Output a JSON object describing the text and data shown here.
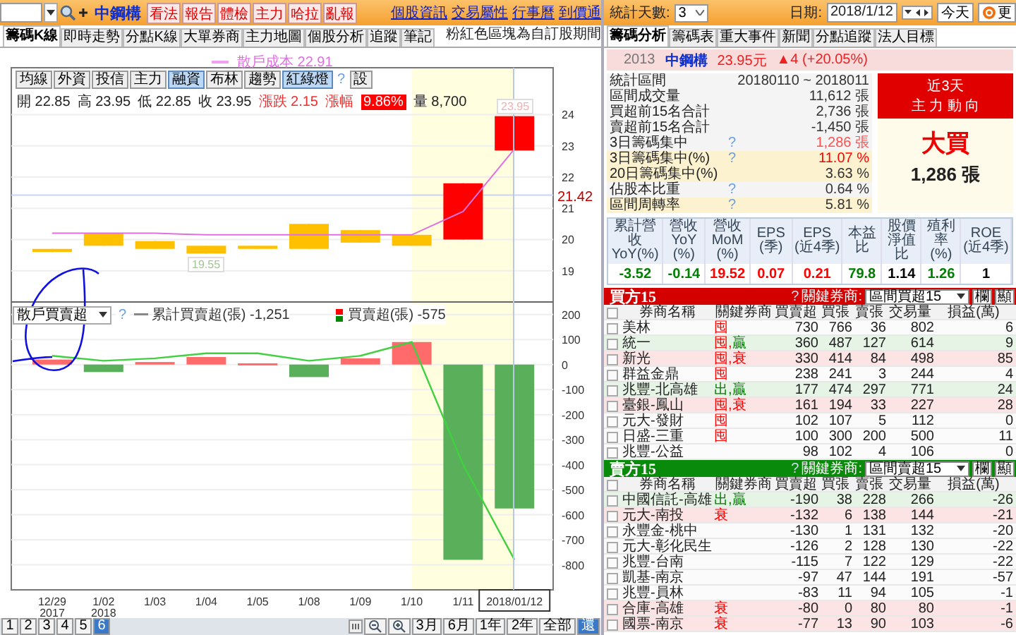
{
  "left": {
    "toolbar": {
      "stock_name": "中鋼構",
      "actions": [
        "看法",
        "報告",
        "體檢",
        "主力",
        "哈拉",
        "亂報"
      ],
      "links": [
        "個股資訊",
        "交易屬性",
        "行事曆",
        "到價通"
      ]
    },
    "tabs": [
      {
        "label": "籌碼K線",
        "selected": true
      },
      {
        "label": "即時走勢",
        "selected": false
      },
      {
        "label": "分點K線",
        "selected": false
      },
      {
        "label": "大單券商",
        "selected": false
      },
      {
        "label": "主力地圖",
        "selected": false
      },
      {
        "label": "個股分析",
        "selected": false
      },
      {
        "label": "追蹤",
        "selected": false
      },
      {
        "label": "筆記",
        "selected": false
      }
    ],
    "note": "粉紅色區塊為自訂股期間",
    "cost_value": "22.91",
    "chart_buttons": [
      {
        "label": "均線",
        "selected": false
      },
      {
        "label": "外資",
        "selected": false
      },
      {
        "label": "投信",
        "selected": false
      },
      {
        "label": "主力",
        "selected": false
      },
      {
        "label": "融資",
        "selected": true
      },
      {
        "label": "布林",
        "selected": false
      },
      {
        "label": "趨勢",
        "selected": false
      },
      {
        "label": "紅綠燈",
        "selected": true
      }
    ],
    "help": "?",
    "settings_button": "設",
    "quote": [
      {
        "label": "開",
        "value": "22.85"
      },
      {
        "label": "高",
        "value": "23.95"
      },
      {
        "label": "低",
        "value": "22.85"
      },
      {
        "label": "收",
        "value": "23.95"
      }
    ],
    "change": {
      "label": "漲跌",
      "value": "2.15"
    },
    "change_pct": {
      "label": "漲幅",
      "value": "9.86%"
    },
    "volume": {
      "label": "量",
      "value": "8,700"
    },
    "price_chart": {
      "high_tag": "23.95",
      "low_tag": "19.55",
      "candles": [
        {
          "color": "#ffc000"
        },
        {
          "color": "#ffc000"
        },
        {
          "color": "#ffc000"
        },
        {
          "color": "#ffc000"
        },
        {
          "color": "#ffc000"
        },
        {
          "color": "#ffc000"
        },
        {
          "color": "#ffc000"
        },
        {
          "color": "#ffc000"
        },
        {
          "color": "#ff0000"
        },
        {
          "color": "#ff0000"
        }
      ],
      "chart_data": {
        "type": "candlestick",
        "ylim": [
          18.0,
          25.5
        ],
        "yticks": [
          19,
          20,
          21,
          22,
          23,
          24
        ],
        "grid": true,
        "ref_lines": [
          {
            "axis": "y",
            "value": 21.42,
            "label": "21.42"
          }
        ],
        "series": [
          {
            "ohlc": [
              [
                19.7,
                19.7,
                19.6,
                19.6
              ],
              [
                20.2,
                20.2,
                19.8,
                19.8
              ],
              [
                19.95,
                19.95,
                19.7,
                19.7
              ],
              [
                19.8,
                19.8,
                19.55,
                19.55
              ],
              [
                19.8,
                19.8,
                19.7,
                19.7
              ],
              [
                20.5,
                20.5,
                19.7,
                19.7
              ],
              [
                20.3,
                20.3,
                19.9,
                19.9
              ],
              [
                20.15,
                20.15,
                19.8,
                19.8
              ],
              [
                20.0,
                21.8,
                20.0,
                21.8
              ],
              [
                22.85,
                23.95,
                22.85,
                23.95
              ]
            ]
          },
          {
            "name": "散戶成本",
            "type": "line",
            "color": "#e070e0",
            "values": [
              20.2,
              20.2,
              20.2,
              20.15,
              20.15,
              20.15,
              20.15,
              20.15,
              20.9,
              22.9
            ]
          }
        ]
      }
    },
    "flow_chart": {
      "selector": "散戶買賣超",
      "help": "?",
      "line_legend_value": "-1,251",
      "bar_legend_value": "-575",
      "year_labels": [
        "2017",
        "2018"
      ],
      "chart_data": {
        "type": "bar",
        "categories": [
          "12/29",
          "1/02",
          "1/03",
          "1/04",
          "1/05",
          "1/08",
          "1/09",
          "1/10",
          "1/11",
          "2018/01/12"
        ],
        "ylim": [
          -900,
          250
        ],
        "yticks": [
          200,
          100,
          0,
          -100,
          -200,
          -300,
          -400,
          -500,
          -600,
          -700,
          -800
        ],
        "grid": true,
        "series": [
          {
            "name": "買賣超(張)",
            "values": [
              20,
              -30,
              10,
              30,
              5,
              -50,
              25,
              90,
              -780,
              -575
            ],
            "colors": [
              "#ff6a6a",
              "#5aaf5a",
              "#ff6a6a",
              "#ff6a6a",
              "#ff6a6a",
              "#5aaf5a",
              "#ff6a6a",
              "#ff6a6a",
              "#5aaf5a",
              "#5aaf5a"
            ]
          },
          {
            "name": "累計買賣超(張)",
            "type": "line",
            "color": "#40d040",
            "values": [
              35,
              15,
              25,
              45,
              45,
              15,
              35,
              90,
              -400,
              -780
            ]
          }
        ]
      }
    },
    "pages": [
      {
        "label": "1",
        "selected": false
      },
      {
        "label": "2",
        "selected": false
      },
      {
        "label": "3",
        "selected": false
      },
      {
        "label": "4",
        "selected": false
      },
      {
        "label": "5",
        "selected": false
      },
      {
        "label": "6",
        "selected": true
      }
    ],
    "ranges": [
      {
        "label": "3月",
        "selected": false
      },
      {
        "label": "6月",
        "selected": false
      },
      {
        "label": "1年",
        "selected": false
      },
      {
        "label": "2年",
        "selected": false
      },
      {
        "label": "全部",
        "selected": false
      },
      {
        "label": "還",
        "selected": true
      }
    ]
  },
  "right": {
    "days_label": "統計天數:",
    "days_value": "3",
    "date_label": "日期:",
    "date_value": "2018/1/12",
    "today_button": "今天",
    "refresh_button": "更",
    "tabs": [
      {
        "label": "籌碼分析",
        "selected": true
      },
      {
        "label": "籌碼表",
        "selected": false
      },
      {
        "label": "重大事件",
        "selected": false
      },
      {
        "label": "新聞",
        "selected": false
      },
      {
        "label": "分點追蹤",
        "selected": false
      },
      {
        "label": "法人目標",
        "selected": false
      }
    ],
    "header": {
      "code": "2013",
      "name": "中鋼構",
      "price": "23.95元",
      "change": "▲4 (+20.05%)"
    },
    "stats": [
      {
        "label": "統計區間",
        "value": "20180110 ~ 2018011",
        "highlighted": false,
        "color": "#333333"
      },
      {
        "label": "區間成交量",
        "value": "11,612 張",
        "highlighted": false,
        "color": "#333333"
      },
      {
        "label": "買超前15名合計",
        "value": "2,736 張",
        "highlighted": false,
        "color": "#333333"
      },
      {
        "label": "賣超前15名合計",
        "value": "-1,450 張",
        "highlighted": false,
        "color": "#333333"
      },
      {
        "label": "3日籌碼集中",
        "help": "?",
        "value": "1,286 張",
        "highlighted": false,
        "color": "#ff5050"
      },
      {
        "label": "3日籌碼集中(%)",
        "help": "?",
        "value": "11.07 %",
        "highlighted": true,
        "color": "#ff0000"
      },
      {
        "label": "20日籌碼集中(%)",
        "value": "3.63 %",
        "highlighted": true,
        "color": "#333333"
      },
      {
        "label": "佔股本比重",
        "help": "?",
        "value": "0.64 %",
        "highlighted": false,
        "color": "#333333"
      },
      {
        "label": "區間周轉率",
        "help": "?",
        "value": "5.81 %",
        "highlighted": true,
        "color": "#333333"
      }
    ],
    "summary": {
      "title": "近3天",
      "subtitle": "主 力 動 向",
      "verdict": "大買",
      "amount": "1,286 張"
    },
    "metrics": [
      {
        "lines": [
          "累計營收",
          "YoY(%)"
        ],
        "value": "-3.52",
        "color": "#008000"
      },
      {
        "lines": [
          "營收",
          "YoY(%)"
        ],
        "value": "-0.14",
        "color": "#008000"
      },
      {
        "lines": [
          "營收",
          "MoM(%)"
        ],
        "value": "19.52",
        "color": "#ff0000"
      },
      {
        "lines": [
          "EPS",
          "(季)"
        ],
        "value": "0.07",
        "color": "#ff0000"
      },
      {
        "lines": [
          "EPS",
          "(近4季)"
        ],
        "value": "0.21",
        "color": "#ff0000"
      },
      {
        "lines": [
          "本益比"
        ],
        "value": "79.8",
        "color": "#008000"
      },
      {
        "lines": [
          "股價",
          "淨值比"
        ],
        "value": "1.14",
        "color": "#000000"
      },
      {
        "lines": [
          "殖利率",
          "(%)"
        ],
        "value": "1.26",
        "color": "#008000"
      },
      {
        "lines": [
          "ROE",
          "(近4季)"
        ],
        "value": "1",
        "color": "#000000"
      }
    ],
    "tables": [
      {
        "kind": "buy",
        "header_checked": false,
        "title": "買方15",
        "help": "?",
        "key_label": "關鍵券商:",
        "key_select": "區間買超15",
        "column_button": "欄",
        "show_button": "顯",
        "name_columns": [
          "券商名稱",
          "關鍵券商"
        ],
        "columns": [
          "買賣超",
          "買張",
          "賣張",
          "交易量",
          "損益(萬)"
        ],
        "rows": [
          {
            "kind": "plain",
            "checked": false,
            "broker": "美林",
            "tags": [
              {
                "text": "囤",
                "color": "#ff0000"
              }
            ],
            "cells": [
              "730",
              "766",
              "36",
              "802",
              "6"
            ]
          },
          {
            "kind": "win",
            "checked": false,
            "broker": "統一",
            "tags": [
              {
                "text": "囤,",
                "color": "#ff0000"
              },
              {
                "text": "贏",
                "color": "#008000"
              }
            ],
            "cells": [
              "360",
              "487",
              "127",
              "614",
              "9"
            ]
          },
          {
            "kind": "lose",
            "checked": false,
            "broker": "新光",
            "tags": [
              {
                "text": "囤,",
                "color": "#ff0000"
              },
              {
                "text": "衰",
                "color": "#ff0000"
              }
            ],
            "cells": [
              "330",
              "414",
              "84",
              "498",
              "85"
            ]
          },
          {
            "kind": "plain",
            "checked": false,
            "broker": "群益金鼎",
            "tags": [
              {
                "text": "囤",
                "color": "#ff0000"
              }
            ],
            "cells": [
              "238",
              "241",
              "3",
              "244",
              "4"
            ]
          },
          {
            "kind": "win",
            "checked": false,
            "broker": "兆豐-北高雄",
            "tags": [
              {
                "text": "出,",
                "color": "#008000"
              },
              {
                "text": "贏",
                "color": "#008000"
              }
            ],
            "cells": [
              "177",
              "474",
              "297",
              "771",
              "24"
            ]
          },
          {
            "kind": "lose",
            "checked": false,
            "broker": "臺銀-鳳山",
            "tags": [
              {
                "text": "囤,",
                "color": "#ff0000"
              },
              {
                "text": "衰",
                "color": "#ff0000"
              }
            ],
            "cells": [
              "161",
              "194",
              "33",
              "227",
              "28"
            ]
          },
          {
            "kind": "plain",
            "checked": false,
            "broker": "元大-發財",
            "tags": [
              {
                "text": "囤",
                "color": "#ff0000"
              }
            ],
            "cells": [
              "102",
              "107",
              "5",
              "112",
              "0"
            ]
          },
          {
            "kind": "plain",
            "checked": false,
            "broker": "日盛-三重",
            "tags": [
              {
                "text": "囤",
                "color": "#ff0000"
              }
            ],
            "cells": [
              "100",
              "300",
              "200",
              "500",
              "11"
            ]
          },
          {
            "kind": "plain",
            "checked": false,
            "broker": "兆豐-公益",
            "tags": [],
            "cells": [
              "98",
              "102",
              "4",
              "106",
              "0"
            ]
          }
        ]
      },
      {
        "kind": "sell",
        "header_checked": false,
        "title": "賣方15",
        "help": "?",
        "key_label": "關鍵券商:",
        "key_select": "區間賣超15",
        "column_button": "欄",
        "show_button": "顯",
        "name_columns": [
          "券商名稱",
          "關鍵券商"
        ],
        "columns": [
          "買賣超",
          "買張",
          "賣張",
          "交易量",
          "損益(萬)"
        ],
        "rows": [
          {
            "kind": "win",
            "checked": false,
            "broker": "中國信託-高雄",
            "tags": [
              {
                "text": "出,",
                "color": "#008000"
              },
              {
                "text": "贏",
                "color": "#008000"
              }
            ],
            "cells": [
              "-190",
              "38",
              "228",
              "266",
              "-26"
            ]
          },
          {
            "kind": "lose",
            "checked": false,
            "broker": "元大-南投",
            "tags": [
              {
                "text": "衰",
                "color": "#ff0000"
              }
            ],
            "cells": [
              "-132",
              "6",
              "138",
              "144",
              "-21"
            ]
          },
          {
            "kind": "plain",
            "checked": false,
            "broker": "永豐金-桃中",
            "tags": [],
            "cells": [
              "-130",
              "1",
              "131",
              "132",
              "-20"
            ]
          },
          {
            "kind": "plain",
            "checked": false,
            "broker": "元大-彰化民生",
            "tags": [],
            "cells": [
              "-126",
              "2",
              "128",
              "130",
              "-22"
            ]
          },
          {
            "kind": "plain",
            "checked": false,
            "broker": "兆豐-台南",
            "tags": [],
            "cells": [
              "-115",
              "7",
              "122",
              "129",
              "-22"
            ]
          },
          {
            "kind": "plain",
            "checked": false,
            "broker": "凱基-南京",
            "tags": [],
            "cells": [
              "-97",
              "47",
              "144",
              "191",
              "-57"
            ]
          },
          {
            "kind": "plain",
            "checked": false,
            "broker": "兆豐-員林",
            "tags": [],
            "cells": [
              "-83",
              "11",
              "94",
              "105",
              "-1"
            ]
          },
          {
            "kind": "lose",
            "checked": false,
            "broker": "合庫-高雄",
            "tags": [
              {
                "text": "衰",
                "color": "#ff0000"
              }
            ],
            "cells": [
              "-80",
              "0",
              "80",
              "80",
              "-1"
            ]
          },
          {
            "kind": "lose",
            "checked": false,
            "broker": "國票-南京",
            "tags": [
              {
                "text": "衰",
                "color": "#ff0000"
              }
            ],
            "cells": [
              "-77",
              "13",
              "90",
              "103",
              "-6"
            ]
          }
        ]
      }
    ]
  }
}
